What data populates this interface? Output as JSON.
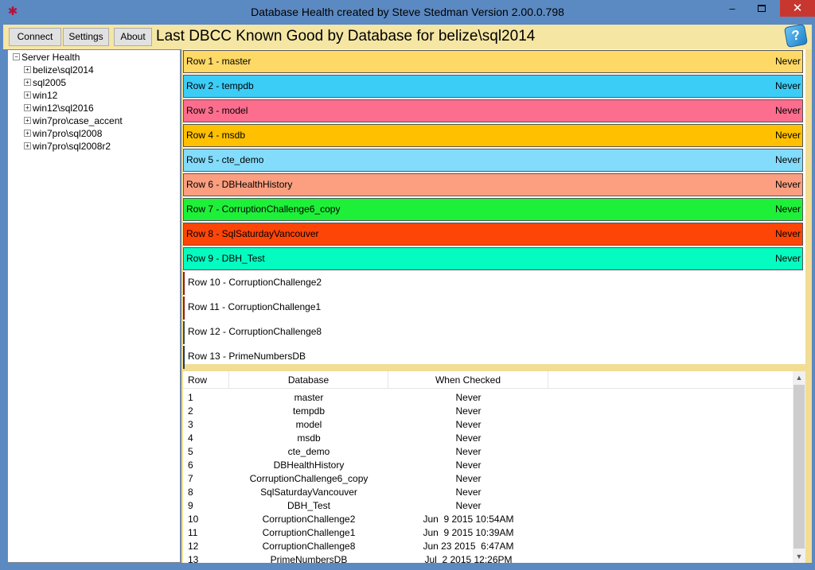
{
  "window": {
    "title": "Database Health created by Steve Stedman Version 2.00.0.798",
    "minimize_glyph": "–",
    "close_glyph": "✕",
    "app_icon_glyph": "✱"
  },
  "toolbar": {
    "connect_label": "Connect",
    "settings_label": "Settings",
    "about_label": "About",
    "page_title": "Last DBCC Known Good by Database for belize\\sql2014",
    "help_glyph": "?"
  },
  "tree": {
    "root": {
      "label": "Server Health",
      "toggle": "−"
    },
    "items": [
      {
        "label": "belize\\sql2014",
        "toggle": "+"
      },
      {
        "label": "sql2005",
        "toggle": "+"
      },
      {
        "label": "win12",
        "toggle": "+"
      },
      {
        "label": "win12\\sql2016",
        "toggle": "+"
      },
      {
        "label": "win7pro\\case_accent",
        "toggle": "+"
      },
      {
        "label": "win7pro\\sql2008",
        "toggle": "+"
      },
      {
        "label": "win7pro\\sql2008r2",
        "toggle": "+"
      }
    ]
  },
  "bars": [
    {
      "label": "Row 1 - master",
      "value": "Never",
      "color": "#ffd966"
    },
    {
      "label": "Row 2 - tempdb",
      "value": "Never",
      "color": "#3ccdf7"
    },
    {
      "label": "Row 3 - model",
      "value": "Never",
      "color": "#fc6d8e"
    },
    {
      "label": "Row 4 - msdb",
      "value": "Never",
      "color": "#ffc000"
    },
    {
      "label": "Row 5 - cte_demo",
      "value": "Never",
      "color": "#83dcfb"
    },
    {
      "label": "Row 6 - DBHealthHistory",
      "value": "Never",
      "color": "#fb9f80"
    },
    {
      "label": "Row 7 - CorruptionChallenge6_copy",
      "value": "Never",
      "color": "#1ef039"
    },
    {
      "label": "Row 8 - SqlSaturdayVancouver",
      "value": "Never",
      "color": "#fd4508"
    },
    {
      "label": "Row 9 - DBH_Test",
      "value": "Never",
      "color": "#05fcc1"
    },
    {
      "label": "Row 10 - CorruptionChallenge2",
      "value": "",
      "color": "#8b1a1a"
    },
    {
      "label": "Row 11 - CorruptionChallenge1",
      "value": "",
      "color": "#8b1a1a"
    },
    {
      "label": "Row 12 - CorruptionChallenge8",
      "value": "",
      "color": "#2f4f4f"
    },
    {
      "label": "Row 13 - PrimeNumbersDB",
      "value": "",
      "color": "#1f3a5a"
    }
  ],
  "grid": {
    "headers": {
      "row": "Row",
      "database": "Database",
      "when": "When Checked"
    },
    "rows": [
      {
        "row": "1",
        "database": "master",
        "when": "Never"
      },
      {
        "row": "2",
        "database": "tempdb",
        "when": "Never"
      },
      {
        "row": "3",
        "database": "model",
        "when": "Never"
      },
      {
        "row": "4",
        "database": "msdb",
        "when": "Never"
      },
      {
        "row": "5",
        "database": "cte_demo",
        "when": "Never"
      },
      {
        "row": "6",
        "database": "DBHealthHistory",
        "when": "Never"
      },
      {
        "row": "7",
        "database": "CorruptionChallenge6_copy",
        "when": "Never"
      },
      {
        "row": "8",
        "database": "SqlSaturdayVancouver",
        "when": "Never"
      },
      {
        "row": "9",
        "database": "DBH_Test",
        "when": "Never"
      },
      {
        "row": "10",
        "database": "CorruptionChallenge2",
        "when": "Jun  9 2015 10:54AM"
      },
      {
        "row": "11",
        "database": "CorruptionChallenge1",
        "when": "Jun  9 2015 10:39AM"
      },
      {
        "row": "12",
        "database": "CorruptionChallenge8",
        "when": "Jun 23 2015  6:47AM"
      },
      {
        "row": "13",
        "database": "PrimeNumbersDB",
        "when": "Jul  2 2015 12:26PM"
      }
    ],
    "scroll_up_glyph": "▲",
    "scroll_down_glyph": "▼"
  }
}
